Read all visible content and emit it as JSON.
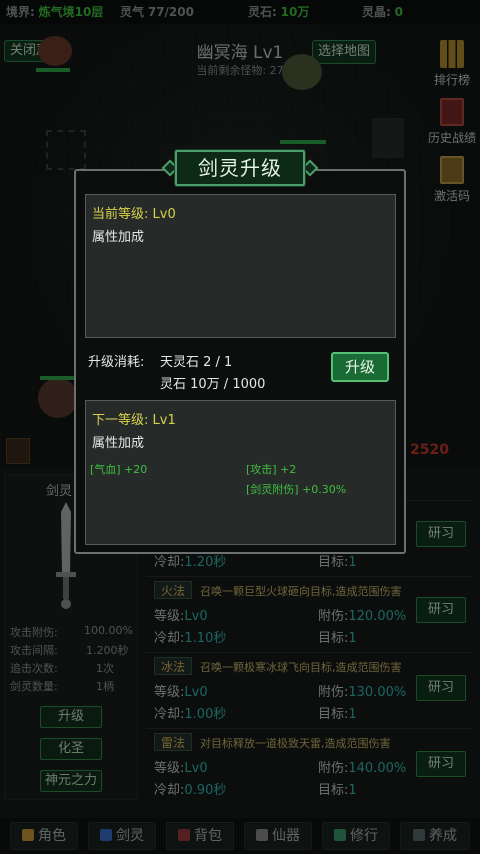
{
  "topbar": {
    "realm_key": "境界:",
    "realm_val": "炼气境10层",
    "qi_key": "灵气",
    "qi_val": "77/200",
    "stone_key": "灵石:",
    "stone_val": "10万",
    "crystal_key": "灵晶:",
    "crystal_val": "0"
  },
  "field": {
    "sound_btn": "关闭声音",
    "map_title": "幽冥海 Lv1",
    "remaining": "当前剩余怪物: 27",
    "select_map_btn": "选择地图",
    "side": [
      {
        "label": "排行榜"
      },
      {
        "label": "历史战绩"
      },
      {
        "label": "激活码"
      }
    ],
    "damage_number": "2520"
  },
  "left_panel": {
    "title": "剑灵",
    "stats": [
      {
        "k": "攻击附伤:",
        "v": "100.00%"
      },
      {
        "k": "攻击间隔:",
        "v": "1.200秒"
      },
      {
        "k": "追击次数:",
        "v": "1次"
      },
      {
        "k": "剑灵数量:",
        "v": "1柄"
      }
    ],
    "buttons": [
      "升级",
      "化圣",
      "神元之力"
    ]
  },
  "skills": [
    {
      "level_label": "等级:",
      "level": "",
      "cool_label": "冷却:",
      "cool": "1.20秒",
      "target_label": "目标:",
      "target": "1",
      "research": "研习"
    },
    {
      "name": "火法",
      "desc": "召唤一颗巨型火球砸向目标,造成范围伤害",
      "level_label": "等级:",
      "level": "Lv0",
      "dmg_label": "附伤:",
      "dmg": "120.00%",
      "cool_label": "冷却:",
      "cool": "1.10秒",
      "target_label": "目标:",
      "target": "1",
      "research": "研习"
    },
    {
      "name": "冰法",
      "desc": "召唤一颗极寒冰球飞向目标,造成范围伤害",
      "level_label": "等级:",
      "level": "Lv0",
      "dmg_label": "附伤:",
      "dmg": "130.00%",
      "cool_label": "冷却:",
      "cool": "1.00秒",
      "target_label": "目标:",
      "target": "1",
      "research": "研习"
    },
    {
      "name": "雷法",
      "desc": "对目标释放一道极致天雷,造成范围伤害",
      "level_label": "等级:",
      "level": "Lv0",
      "dmg_label": "附伤:",
      "dmg": "140.00%",
      "cool_label": "冷却:",
      "cool": "0.90秒",
      "target_label": "目标:",
      "target": "1",
      "research": "研习"
    }
  ],
  "bottom_nav": [
    "角色",
    "剑灵",
    "背包",
    "仙器",
    "修行",
    "养成"
  ],
  "dialog": {
    "title": "剑灵升级",
    "current_level": "当前等级: Lv0",
    "current_bonus": "属性加成",
    "cost_label": "升级消耗:",
    "cost_item1": "天灵石 2 / 1",
    "cost_item2": "灵石 10万 / 1000",
    "upgrade_btn": "升级",
    "next_level": "下一等级: Lv1",
    "next_bonus": "属性加成",
    "effects": [
      {
        "text": "[气血] +20"
      },
      {
        "text": "[攻击] +2"
      },
      {
        "text": "[剑灵附伤] +0.30%"
      }
    ]
  },
  "colors": {
    "accent_green": "#2f8a4a",
    "effect_green": "#3fbf3f",
    "level_yellow": "#d8d24a",
    "damage_red": "#c0392b"
  }
}
